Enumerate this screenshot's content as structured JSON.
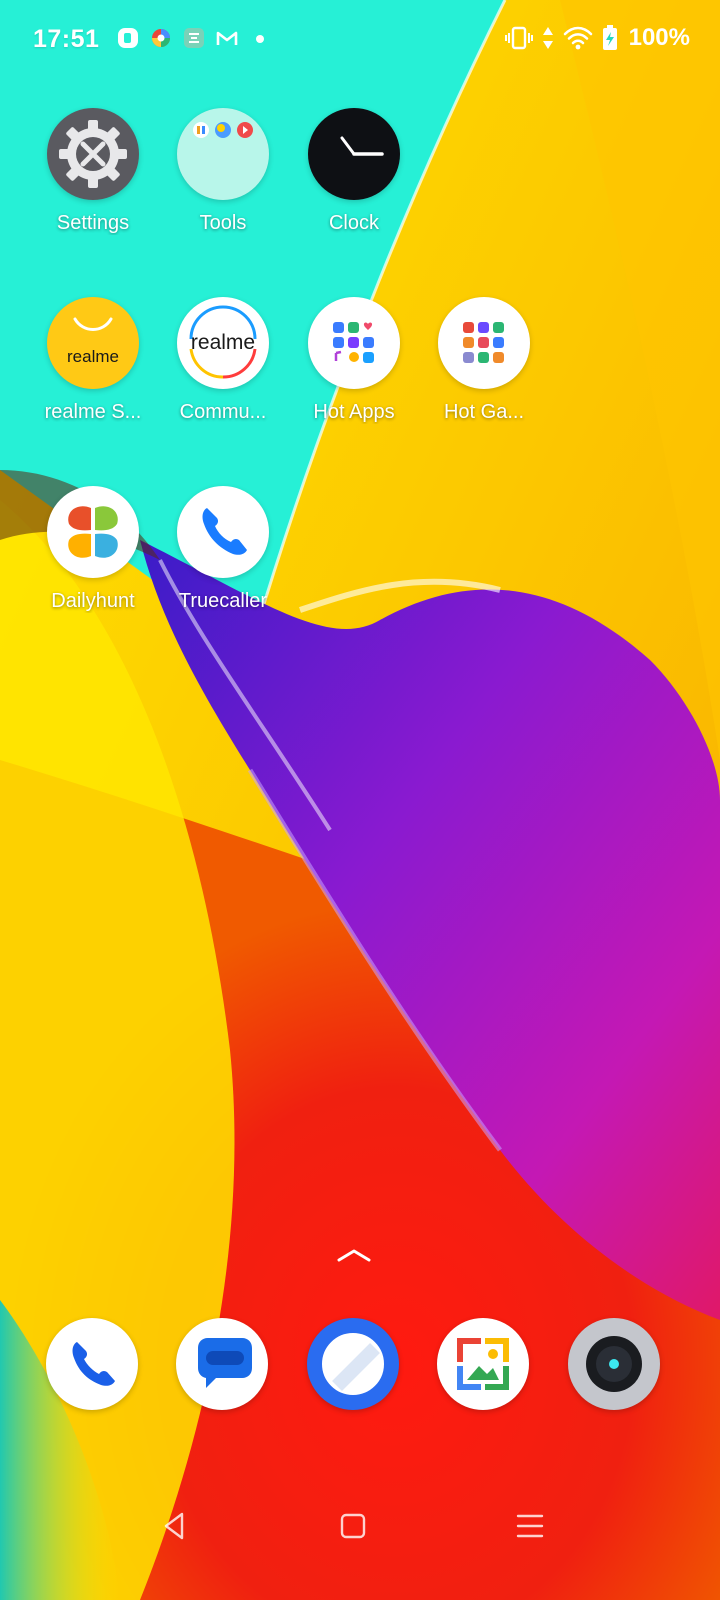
{
  "status_bar": {
    "time": "17:51",
    "notification_icons": [
      "r-app-icon",
      "color-wheel-icon",
      "tools-icon",
      "gmail-icon",
      "dot-icon"
    ],
    "battery": "100%",
    "system_icons": [
      "vibrate-icon",
      "data-arrows-icon",
      "wifi-icon",
      "battery-charging-icon"
    ]
  },
  "apps": {
    "settings": "Settings",
    "tools": "Tools",
    "clock": "Clock",
    "realme_store": "realme S...",
    "community": "Commu...",
    "hot_apps": "Hot Apps",
    "hot_games": "Hot Ga...",
    "dailyhunt": "Dailyhunt",
    "truecaller": "Truecaller"
  },
  "icon_text": {
    "realme_yellow": "realme",
    "realme_community": "realme"
  },
  "dock": [
    "phone-icon",
    "messages-icon",
    "browser-icon",
    "gallery-icon",
    "camera-icon"
  ],
  "nav": [
    "back-icon",
    "home-icon",
    "recents-icon"
  ],
  "colors": {
    "wallpaper_teal": "#26f0d6",
    "wallpaper_yellow": "#fcd200",
    "wallpaper_red": "#f01c10",
    "wallpaper_purple": "#8c1cc8"
  }
}
